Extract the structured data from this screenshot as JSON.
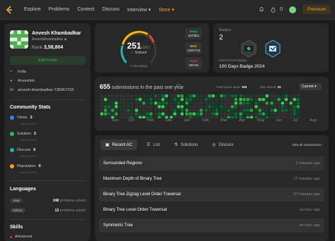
{
  "nav": {
    "links": [
      "Explore",
      "Problems",
      "Contest",
      "Discuss",
      "Interview",
      "Store"
    ],
    "streak": "0",
    "premium": "Premium"
  },
  "profile": {
    "name": "Anvesh Khambadkar",
    "username": "Anveshkhambadkar",
    "rank_label": "Rank",
    "rank": "3,58,804",
    "edit": "Edit Profile",
    "location": "India",
    "github": "Anveshkh",
    "linkedin": "anvesh-khambadkar-736967233"
  },
  "community": {
    "title": "Community Stats",
    "items": [
      {
        "label": "Views",
        "value": "2",
        "sub": "Last week",
        "delta": "0",
        "color": "#3b82f6"
      },
      {
        "label": "Solution",
        "value": "2",
        "sub": "Last week",
        "delta": "0",
        "color": "#2cbb5d"
      },
      {
        "label": "Discuss",
        "value": "0",
        "sub": "Last week",
        "delta": "0",
        "color": "#14b8a6"
      },
      {
        "label": "Reputation",
        "value": "0",
        "sub": "Last week",
        "delta": "0",
        "color": "#ffa116"
      }
    ]
  },
  "languages": {
    "title": "Languages",
    "items": [
      {
        "name": "Java",
        "count": "248",
        "suffix": "problems solved"
      },
      {
        "name": "Python",
        "count": "13",
        "suffix": "problems solved"
      }
    ]
  },
  "skills": {
    "title": "Skills",
    "first": "Advanced"
  },
  "solved": {
    "count": "251",
    "total": "/3267",
    "label": "Solved",
    "attempting": "7 Attempting",
    "easy": {
      "label": "Easy",
      "value": "107/821",
      "color": "#1cbaba"
    },
    "medium": {
      "label": "Med.",
      "value": "115/1712",
      "color": "#ffb700"
    },
    "hard": {
      "label": "Hard",
      "value": "29/734",
      "color": "#f63737"
    }
  },
  "badges": {
    "label": "Badges",
    "count": "2",
    "recent_label": "Most Recent Badge",
    "recent_name": "100 Days Badge 2024"
  },
  "heatmap": {
    "count": "655",
    "title_suffix": "submissions in the past one year",
    "active_label": "Total active days:",
    "active_days": "193",
    "streak_label": "Max streak:",
    "max_streak": "22",
    "select": "Current",
    "months": [
      "Sep",
      "Oct",
      "Nov",
      "Dec",
      "Jan",
      "Feb",
      "Mar",
      "Apr",
      "May",
      "Jun",
      "Jul",
      "Aug"
    ]
  },
  "recent": {
    "tabs": [
      "Recent AC",
      "List",
      "Solutions",
      "Discuss"
    ],
    "view_all": "View all submissions",
    "items": [
      {
        "title": "Surrounded Regions",
        "time": "2 minutes ago"
      },
      {
        "title": "Maximum Depth of Binary Tree",
        "time": "17 minutes ago"
      },
      {
        "title": "Binary Tree Zigzag Level Order Traversal",
        "time": "37 minutes ago"
      },
      {
        "title": "Binary Tree Level Order Traversal",
        "time": "an hour ago"
      },
      {
        "title": "Symmetric Tree",
        "time": "an hour ago"
      }
    ]
  },
  "colors": {
    "accent": "#ffa116",
    "green": "#2cbb5d",
    "card": "#282828",
    "bg": "#1a1a1a"
  }
}
